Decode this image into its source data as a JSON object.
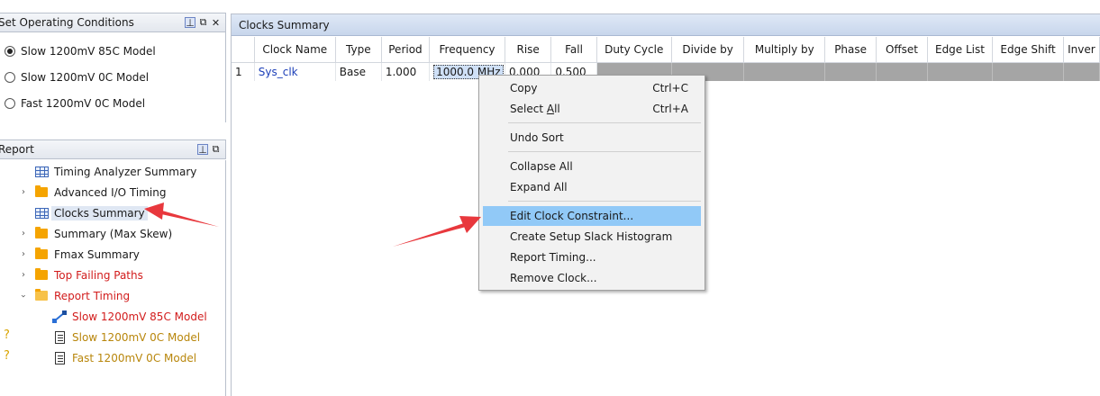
{
  "conditions_panel": {
    "title": "Set Operating Conditions",
    "options": [
      {
        "label": "Slow 1200mV 85C Model",
        "selected": true
      },
      {
        "label": "Slow 1200mV 0C Model",
        "selected": false
      },
      {
        "label": "Fast 1200mV 0C Model",
        "selected": false
      }
    ]
  },
  "report_panel": {
    "title": "Report",
    "items": [
      {
        "label": "Timing Analyzer Summary"
      },
      {
        "label": "Advanced I/O Timing"
      },
      {
        "label": "Clocks Summary"
      },
      {
        "label": "Summary (Max Skew)"
      },
      {
        "label": "Fmax Summary"
      },
      {
        "label": "Top Failing Paths"
      },
      {
        "label": "Report Timing"
      },
      {
        "label": "Slow 1200mV 85C Model"
      },
      {
        "label": "Slow 1200mV 0C Model"
      },
      {
        "label": "Fast 1200mV 0C Model"
      }
    ],
    "question_mark": "?"
  },
  "clocks_summary": {
    "title": "Clocks Summary",
    "columns": [
      "Clock Name",
      "Type",
      "Period",
      "Frequency",
      "Rise",
      "Fall",
      "Duty Cycle",
      "Divide by",
      "Multiply by",
      "Phase",
      "Offset",
      "Edge List",
      "Edge Shift",
      "Inver"
    ],
    "row": {
      "index": "1",
      "clock_name": "Sys_clk",
      "type": "Base",
      "period": "1.000",
      "frequency": "1000.0 MHz",
      "rise": "0.000",
      "fall": "0.500"
    }
  },
  "context_menu": {
    "copy": "Copy",
    "copy_shortcut": "Ctrl+C",
    "select_all_prefix": "Select ",
    "select_all_ul": "A",
    "select_all_suffix": "ll",
    "select_all_shortcut": "Ctrl+A",
    "undo_sort": "Undo Sort",
    "collapse_all": "Collapse All",
    "expand_all": "Expand All",
    "edit_clock": "Edit Clock Constraint...",
    "create_hist": "Create Setup Slack Histogram",
    "report_timing": "Report Timing...",
    "remove_clock": "Remove Clock..."
  },
  "colors": {
    "annotation_arrow": "#e8383d",
    "menu_highlight": "#91c9f7",
    "link_text": "#1c3fb8",
    "failing_text": "#d21c1c"
  }
}
